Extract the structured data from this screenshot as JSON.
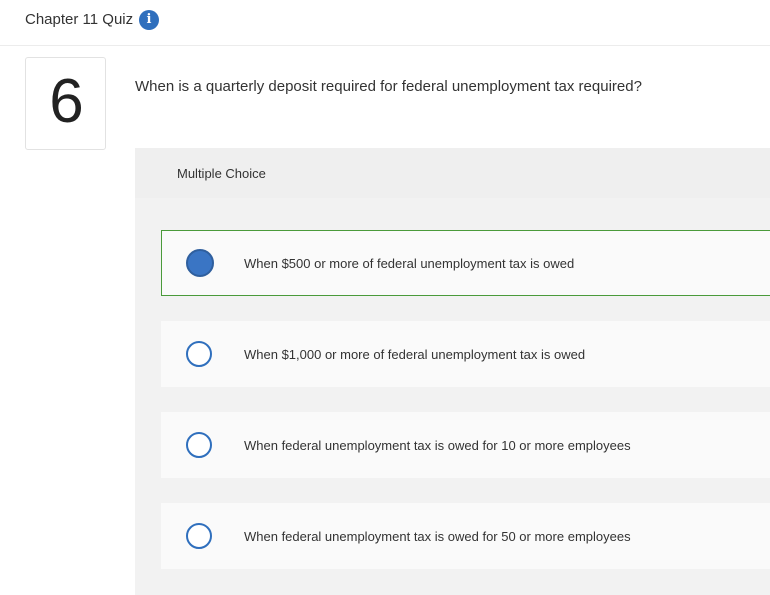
{
  "header": {
    "title": "Chapter 11 Quiz",
    "info_icon": "info-icon"
  },
  "question": {
    "number": "6",
    "text": "When is a quarterly deposit required for federal unemployment tax required?"
  },
  "panel": {
    "type_label": "Multiple Choice"
  },
  "choices": [
    {
      "text": "When $500 or more of federal unemployment tax is owed",
      "selected": true
    },
    {
      "text": "When $1,000 or more of federal unemployment tax is owed",
      "selected": false
    },
    {
      "text": "When federal unemployment tax is owed for 10 or more employees",
      "selected": false
    },
    {
      "text": "When federal unemployment tax is owed for 50 or more employees",
      "selected": false
    }
  ],
  "colors": {
    "accent_blue": "#2f6fbd",
    "selected_border": "#4a9a3a",
    "panel_bg": "#f2f2f2"
  }
}
